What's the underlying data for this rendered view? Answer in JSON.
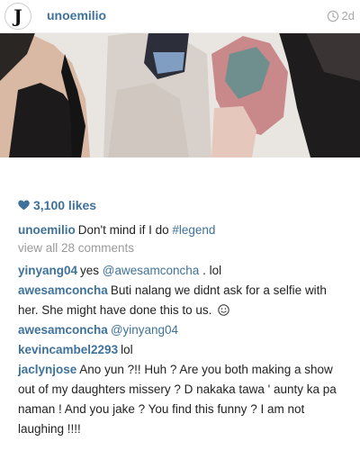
{
  "post": {
    "username": "unoemilio",
    "timestamp": "2d",
    "avatar_letter": "J",
    "likes": "3,100 likes",
    "caption": {
      "user": "unoemilio",
      "text": "Don't mind if I do ",
      "hashtag": "#legend"
    },
    "view_all": "view all 28 comments"
  },
  "comments": [
    {
      "user": "yinyang04",
      "pre": "yes ",
      "mention": "@awesamconcha",
      "post": " . lol"
    },
    {
      "user": "awesamconcha",
      "pre": "Buti nalang we didnt ask for a selfie with her. She might have done this to us. ",
      "mention": "",
      "post": "",
      "emoji": "smiley-icon"
    },
    {
      "user": "awesamconcha",
      "pre": "",
      "mention": "@yinyang04",
      "post": ""
    },
    {
      "user": "kevincambel2293",
      "pre": "lol",
      "mention": "",
      "post": ""
    },
    {
      "user": "jaclynjose",
      "pre": "Ano yun ?!! Huh ? Are you both  making a show out of my daughters missery ? D nakaka tawa ' aunty ka pa naman ! And you jake ? You find this funny ? I am not laughing !!!!",
      "mention": "",
      "post": ""
    }
  ],
  "colors": {
    "link": "#3f729b",
    "muted": "#9a9a9a",
    "heart": "#3f729b"
  }
}
